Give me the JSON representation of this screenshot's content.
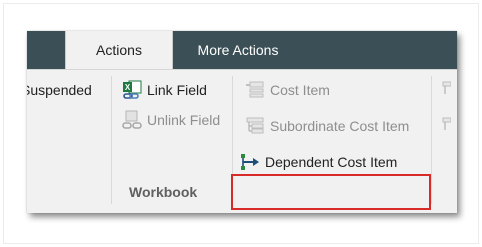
{
  "tabs": [
    {
      "label": "Actions",
      "active": true
    },
    {
      "label": "More Actions",
      "active": false
    }
  ],
  "left_group": {
    "suspended_label": "Suspended"
  },
  "workbook_group": {
    "label": "Workbook",
    "link_field": {
      "label": "Link Field",
      "icon": "excel-link-icon",
      "enabled": true
    },
    "unlink_field": {
      "label": "Unlink Field",
      "icon": "unlink-icon",
      "enabled": false
    }
  },
  "cost_item_group": {
    "cost_item": {
      "label": "Cost Item",
      "icon": "cost-item-icon",
      "enabled": false
    },
    "subordinate_cost_item": {
      "label": "Subordinate Cost Item",
      "icon": "subordinate-cost-item-icon",
      "enabled": false
    },
    "dependent_cost_item": {
      "label": "Dependent Cost Item",
      "icon": "dependent-cost-item-icon",
      "enabled": true,
      "highlighted": true
    }
  },
  "colors": {
    "tab_strip": "#3b4f56",
    "ribbon_background": "#f1f1f1",
    "highlight": "#d92a2a",
    "disabled_text": "#8e8e8e"
  }
}
